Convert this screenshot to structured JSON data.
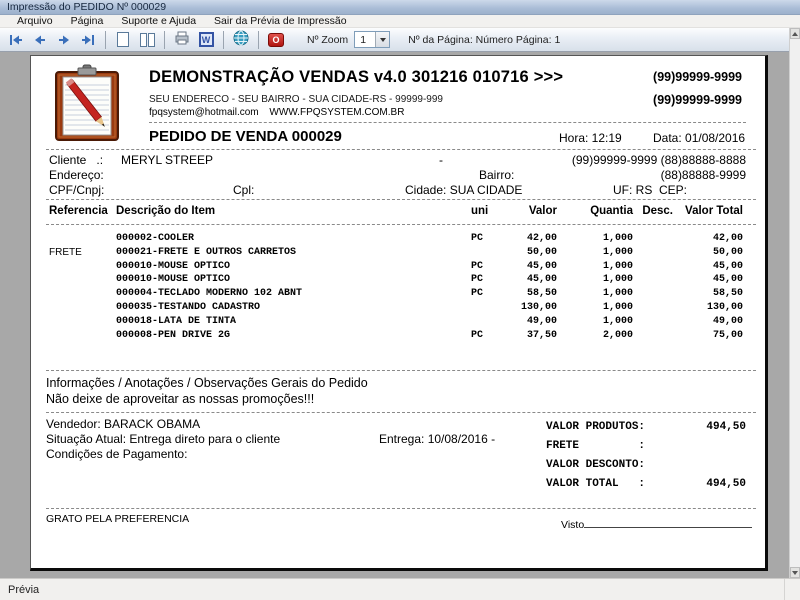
{
  "window": {
    "title": "Impressão do PEDIDO Nº 000029",
    "menu": [
      "Arquivo",
      "Página",
      "Suporte e Ajuda",
      "Sair da Prévia de Impressão"
    ],
    "toolbar": {
      "zoom_label": "Nº Zoom",
      "zoom_value": "1",
      "page_info": "Nº da Página: Número Página: 1",
      "word_glyph": "W",
      "red_glyph": "O",
      "icons": [
        "first-page",
        "previous-page",
        "next-page",
        "last-page",
        "single-page",
        "two-pages",
        "print",
        "export-word",
        "web",
        "close-preview"
      ]
    },
    "status": "Prévia"
  },
  "colors": {
    "titlebar_top": "#cdd9ea",
    "titlebar_bottom": "#9db1cc",
    "nav_arrow_blue": "#3a6fba",
    "close_icon_red": "#b01510",
    "preview_background": "#a8a8a8"
  },
  "doc": {
    "header": {
      "company": "DEMONSTRAÇÃO VENDAS v4.0 301216 010716 >>>",
      "address": "SEU ENDERECO - SEU BAIRRO - SUA CIDADE-RS - 99999-999",
      "email": "fpqsystem@hotmail.com",
      "website": "WWW.FPQSYSTEM.COM.BR",
      "phone1": "(99)99999-9999",
      "phone2": "(99)99999-9999",
      "order_title": "PEDIDO DE VENDA 000029",
      "hora": "Hora: 12:19",
      "data": "Data: 01/08/2016"
    },
    "customer": {
      "cliente_label": "Cliente   .:",
      "cliente_name": "MERYL STREEP",
      "dash": "-",
      "phones_right": "(99)99999-9999  (88)88888-8888",
      "endereco_label": "Endereço:",
      "bairro_label": "Bairro:",
      "phone3": "(88)88888-9999",
      "cpf_label": "CPF/Cnpj:",
      "cpl_label": "Cpl:",
      "cidade": "Cidade: SUA CIDADE",
      "uf_cep": "UF: RS  CEP:"
    },
    "table": {
      "headers": {
        "ref": "Referencia",
        "desc": "Descrição do Item",
        "uni": "uni",
        "valor": "Valor",
        "qty": "Quantia",
        "disc": "Desc.",
        "total": "Valor Total"
      },
      "rows": [
        {
          "ref": "",
          "desc": "000002-COOLER",
          "uni": "PC",
          "valor": "42,00",
          "qty": "1,000",
          "disc": "",
          "total": "42,00"
        },
        {
          "ref": "FRETE",
          "desc": "000021-FRETE E OUTROS CARRETOS",
          "uni": "",
          "valor": "50,00",
          "qty": "1,000",
          "disc": "",
          "total": "50,00"
        },
        {
          "ref": "",
          "desc": "000010-MOUSE OPTICO",
          "uni": "PC",
          "valor": "45,00",
          "qty": "1,000",
          "disc": "",
          "total": "45,00"
        },
        {
          "ref": "",
          "desc": "000010-MOUSE OPTICO",
          "uni": "PC",
          "valor": "45,00",
          "qty": "1,000",
          "disc": "",
          "total": "45,00"
        },
        {
          "ref": "",
          "desc": "000004-TECLADO MODERNO 102 ABNT",
          "uni": "PC",
          "valor": "58,50",
          "qty": "1,000",
          "disc": "",
          "total": "58,50"
        },
        {
          "ref": "",
          "desc": "000035-TESTANDO CADASTRO",
          "uni": "",
          "valor": "130,00",
          "qty": "1,000",
          "disc": "",
          "total": "130,00"
        },
        {
          "ref": "",
          "desc": "000018-LATA DE TINTA",
          "uni": "",
          "valor": "49,00",
          "qty": "1,000",
          "disc": "",
          "total": "49,00"
        },
        {
          "ref": "",
          "desc": "000008-PEN DRIVE 2G",
          "uni": "PC",
          "valor": "37,50",
          "qty": "2,000",
          "disc": "",
          "total": "75,00"
        }
      ]
    },
    "notes": {
      "title": "Informações / Anotações / Observações Gerais do Pedido",
      "message": "Não deixe de aproveitar as nossas promoções!!!"
    },
    "footer": {
      "vendedor": "Vendedor: BARACK OBAMA",
      "situacao": "Situação Atual: Entrega direto para o cliente",
      "entrega": "Entrega: 10/08/2016 -",
      "condicoes": "Condições de Pagamento:",
      "grato": "GRATO PELA PREFERENCIA",
      "visto": "Visto"
    },
    "totals": {
      "rows": [
        {
          "label": "VALOR PRODUTOS:",
          "value": "494,50"
        },
        {
          "label": "FRETE         :",
          "value": ""
        },
        {
          "label": "VALOR DESCONTO:",
          "value": ""
        },
        {
          "label": "VALOR TOTAL   :",
          "value": "494,50"
        }
      ]
    }
  }
}
